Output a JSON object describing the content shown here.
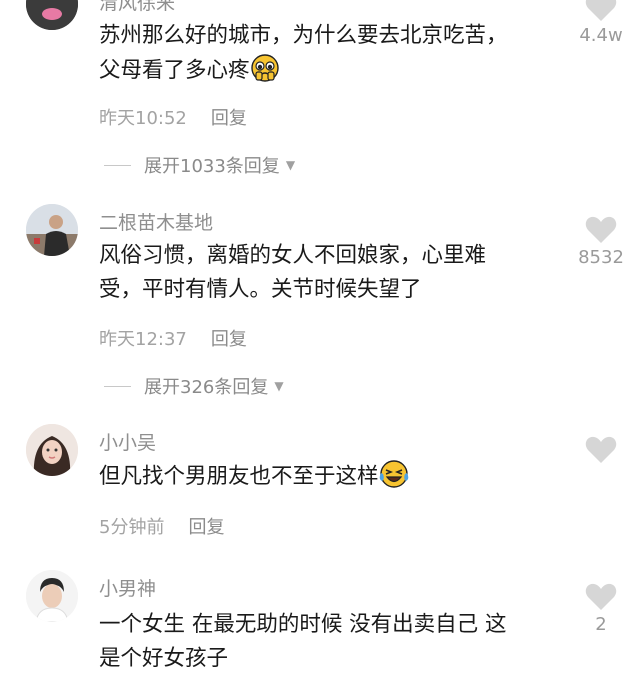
{
  "comments": [
    {
      "username": "清风徐来",
      "content_line1": "苏州那么好的城市，为什么要去北京吃苦，",
      "content_line2": "父母看了多心疼",
      "emoji": "pleading-face-emoji",
      "time": "昨天10:52",
      "reply": "回复",
      "expand": "展开1033条回复",
      "likes": "4.4w"
    },
    {
      "username": "二根苗木基地",
      "content_line1": "风俗习惯，离婚的女人不回娘家，心里难",
      "content_line2": "受，平时有情人。关节时候失望了",
      "time": "昨天12:37",
      "reply": "回复",
      "expand": "展开326条回复",
      "likes": "8532"
    },
    {
      "username": "小小吴",
      "content_line1": "但凡找个男朋友也不至于这样",
      "emoji": "laughing-crying-emoji",
      "time": "5分钟前",
      "reply": "回复",
      "likes": ""
    },
    {
      "username": "小男神",
      "content_line1": "一个女生 在最无助的时候 没有出卖自己 这",
      "content_line2": "是个好女孩子",
      "likes": "2"
    }
  ],
  "icons": {
    "like": "heart-icon",
    "expand": "caret-down-icon"
  },
  "colors": {
    "heart": "#d6d6d6",
    "meta": "#a3a3a3",
    "text": "#1a1a1a"
  }
}
